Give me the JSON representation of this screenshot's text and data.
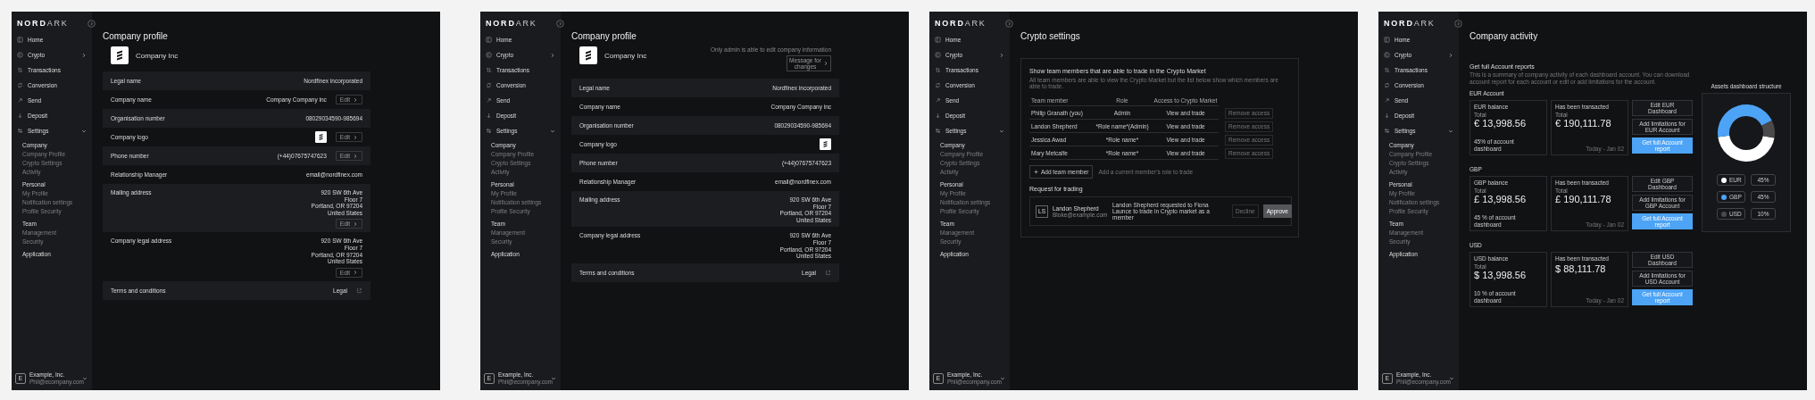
{
  "screens": [
    {
      "kind": "profile",
      "sidebar": {
        "logo": "**NORD**ARK",
        "nav": [
          {
            "label": "Home"
          },
          {
            "label": "Crypto",
            "expanded": false
          },
          {
            "label": "Transactions"
          },
          {
            "label": "Conversion"
          },
          {
            "label": "Send"
          },
          {
            "label": "Deposit"
          },
          {
            "label": "Settings",
            "expanded": true
          }
        ],
        "groups": [
          {
            "label": "Company",
            "items": [
              "Company Profile",
              "Crypto Settings",
              "Activity"
            ]
          },
          {
            "label": "Personal",
            "items": [
              "My Profile",
              "Notification settings",
              "Profile Security"
            ]
          },
          {
            "label": "Team",
            "items": [
              "Management",
              "Security"
            ]
          },
          {
            "label": "Application"
          }
        ],
        "account": {
          "initial": "E",
          "name": "Example, Inc.",
          "email": "Phil@ecompany.com"
        }
      },
      "title": "Company profile",
      "company_name": "Company Inc",
      "rows": [
        {
          "kind": "text",
          "label": "Legal name",
          "value": "Nordfinex incorporated"
        },
        {
          "kind": "text",
          "label": "Company name",
          "value": "Company Company inc",
          "button": "Edit"
        },
        {
          "kind": "text",
          "label": "Organisation number",
          "value": "08029034590-985694"
        },
        {
          "kind": "logo",
          "label": "Company logo",
          "button": "Edit"
        },
        {
          "kind": "text",
          "label": "Phone number",
          "value": "(+44)07675747623",
          "button": "Edit"
        },
        {
          "kind": "text",
          "label": "Relationship Manager",
          "value": "email@nordfinex.com"
        },
        {
          "kind": "address",
          "label": "Mailing address",
          "lines": [
            "920 SW 6th Ave",
            "Floor 7",
            "Portland, OR 97204",
            "United States"
          ],
          "button": "Edit"
        },
        {
          "kind": "address",
          "label": "Company legal address",
          "lines": [
            "920 SW 6th Ave",
            "Floor 7",
            "Portland, OR 97204",
            "United States"
          ],
          "button": "Edit"
        },
        {
          "kind": "link",
          "label": "Terms and conditions",
          "link": "Legal"
        }
      ]
    },
    {
      "kind": "profile",
      "sidebar": {
        "logo": "**NORD**ARK",
        "nav": [
          {
            "label": "Home"
          },
          {
            "label": "Crypto",
            "expanded": false
          },
          {
            "label": "Transactions"
          },
          {
            "label": "Conversion"
          },
          {
            "label": "Send"
          },
          {
            "label": "Deposit"
          },
          {
            "label": "Settings",
            "expanded": true
          }
        ],
        "groups": [
          {
            "label": "Company",
            "items": [
              "Company Profile",
              "Crypto Settings",
              "Activity"
            ]
          },
          {
            "label": "Personal",
            "items": [
              "My Profile",
              "Notification settings",
              "Profile Security"
            ]
          },
          {
            "label": "Team",
            "items": [
              "Management",
              "Security"
            ]
          },
          {
            "label": "Application"
          }
        ],
        "account": {
          "initial": "E",
          "name": "Example, Inc.",
          "email": "Phil@ecompany.com"
        }
      },
      "title": "Company profile",
      "company_name": "Company Inc",
      "notice": {
        "text": "Only admin is able to edit company information",
        "button": "Message for changes"
      },
      "rows": [
        {
          "kind": "text",
          "label": "Legal name",
          "value": "Nordfinex incorporated"
        },
        {
          "kind": "text",
          "label": "Company name",
          "value": "Company Company inc"
        },
        {
          "kind": "text",
          "label": "Organisation number",
          "value": "08029034590-985694"
        },
        {
          "kind": "logo",
          "label": "Company logo"
        },
        {
          "kind": "text",
          "label": "Phone number",
          "value": "(+44)07675747623"
        },
        {
          "kind": "text",
          "label": "Relationship Manager",
          "value": "email@nordfinex.com"
        },
        {
          "kind": "address",
          "label": "Mailing address",
          "lines": [
            "920 SW 6th Ave",
            "Floor 7",
            "Portland, OR 97204",
            "United States"
          ]
        },
        {
          "kind": "address",
          "label": "Company legal address",
          "lines": [
            "920 SW 6th Ave",
            "Floor 7",
            "Portland, OR 97204",
            "United States"
          ]
        },
        {
          "kind": "link",
          "label": "Terms and conditions",
          "link": "Legal"
        }
      ]
    },
    {
      "kind": "crypto",
      "sidebar": {
        "logo": "**NORD**ARK",
        "nav": [
          {
            "label": "Home"
          },
          {
            "label": "Crypto",
            "expanded": false
          },
          {
            "label": "Transactions"
          },
          {
            "label": "Conversion"
          },
          {
            "label": "Send"
          },
          {
            "label": "Deposit"
          },
          {
            "label": "Settings",
            "expanded": true
          }
        ],
        "groups": [
          {
            "label": "Company",
            "items": [
              "Company Profile",
              "Crypto Settings",
              "Activity"
            ]
          },
          {
            "label": "Personal",
            "items": [
              "My Profile",
              "Notification settings",
              "Profile Security"
            ]
          },
          {
            "label": "Team",
            "items": [
              "Management",
              "Security"
            ]
          },
          {
            "label": "Application"
          }
        ],
        "account": {
          "initial": "E",
          "name": "Example, Inc.",
          "email": "Phil@ecompany.com"
        }
      },
      "title": "Crypto settings",
      "heading": "Show team members that are able to trade in the Crypto Market",
      "subheading": "All team members are able to view the Crypto Market but the list below show which members are able to trade.",
      "table": {
        "columns": [
          "Team member",
          "Role",
          "Access to Crypto Market"
        ],
        "rows": [
          {
            "cells": [
              "Philip Granath (you)",
              "Admin",
              "View and trade"
            ],
            "action": "Remove access"
          },
          {
            "cells": [
              "Landon Shepherd",
              "*Role name*(Admin)",
              "View and trade"
            ],
            "action": "Remove access"
          },
          {
            "cells": [
              "Jessica Awad",
              "*Role name*",
              "View and trade"
            ],
            "action": "Remove access"
          },
          {
            "cells": [
              "Mary Metcalfe",
              "*Role name*",
              "View and trade"
            ],
            "action": "Remove access"
          }
        ]
      },
      "add_button": "Add team member",
      "add_hint": "Add a current member's role to trade",
      "requests_title": "Request for trading",
      "requests": [
        {
          "initials": "LS",
          "name": "Landon Shepherd",
          "email": "Bloke@example.com",
          "message": "Landon Shepherd requested to Fiona Launce to trade in Crypto market as a member",
          "decline": "Decline",
          "approve": "Approve"
        }
      ]
    },
    {
      "kind": "activity",
      "sidebar": {
        "logo": "**NORD**ARK",
        "nav": [
          {
            "label": "Home"
          },
          {
            "label": "Crypto",
            "expanded": false
          },
          {
            "label": "Transactions"
          },
          {
            "label": "Conversion"
          },
          {
            "label": "Send"
          },
          {
            "label": "Deposit"
          },
          {
            "label": "Settings",
            "expanded": true
          }
        ],
        "groups": [
          {
            "label": "Company",
            "items": [
              "Company Profile",
              "Crypto Settings",
              "Activity"
            ]
          },
          {
            "label": "Personal",
            "items": [
              "My Profile",
              "Notification settings",
              "Profile Security"
            ]
          },
          {
            "label": "Team",
            "items": [
              "Management",
              "Security"
            ]
          },
          {
            "label": "Application"
          }
        ],
        "account": {
          "initial": "E",
          "name": "Example, Inc.",
          "email": "Phil@ecompany.com"
        }
      },
      "title": "Company activity",
      "intro_title": "Get full Account reports",
      "intro_text": "This is a summary of company activity of each dashboard account. You can download account report for each account or edit or add limitations for the account.",
      "accounts": [
        {
          "label": "EUR Account",
          "balance": {
            "label": "EUR balance",
            "total": "Total",
            "amount": "€ 13,998.56",
            "note": "45% of account dashboard"
          },
          "transacted": {
            "label": "Has been transacted",
            "total": "Total",
            "amount": "€ 190,111.78",
            "date": "Today - Jan 02"
          },
          "buttons": [
            {
              "kind": "outline",
              "label": "Edit EUR Dashboard"
            },
            {
              "kind": "outline",
              "label": "Add limitations for EUR Account"
            },
            {
              "kind": "primary",
              "label": "Get full Account report"
            }
          ]
        },
        {
          "label": "GBP",
          "balance": {
            "label": "GBP balance",
            "total": "Total",
            "amount": "£ 13,998.56",
            "note": "45 % of account dashboard"
          },
          "transacted": {
            "label": "Has been transacted",
            "total": "Total",
            "amount": "£ 190,111.78",
            "date": "Today - Jan 02"
          },
          "buttons": [
            {
              "kind": "outline",
              "label": "Edit GBP Dashboard"
            },
            {
              "kind": "outline",
              "label": "Add limitations for GBP Account"
            },
            {
              "kind": "primary",
              "label": "Get full Account report"
            }
          ]
        },
        {
          "label": "USD",
          "balance": {
            "label": "USD balance",
            "total": "Total",
            "amount": "$ 13,998.56",
            "note": "10 % of account dashboard"
          },
          "transacted": {
            "label": "Has been transacted",
            "amount": "$ 88,111.78",
            "date": "Today - Jan 02"
          },
          "buttons": [
            {
              "kind": "outline",
              "label": "Edit USD Dashboard"
            },
            {
              "kind": "outline",
              "label": "Add limitations for USD Account"
            },
            {
              "kind": "primary",
              "label": "Get full Account report"
            }
          ]
        }
      ],
      "structure": {
        "chart_data": {
          "type": "donut",
          "title": "Assets dashboard structure",
          "categories": [
            "EUR",
            "GBP",
            "USD"
          ],
          "values": [
            45,
            45,
            10
          ]
        },
        "legend": [
          {
            "color": "#ffffff",
            "share": "45%"
          },
          {
            "color": "#4da3f5",
            "share": "45%"
          },
          {
            "color": "#4a4a4a",
            "share": "10%"
          }
        ]
      }
    }
  ]
}
